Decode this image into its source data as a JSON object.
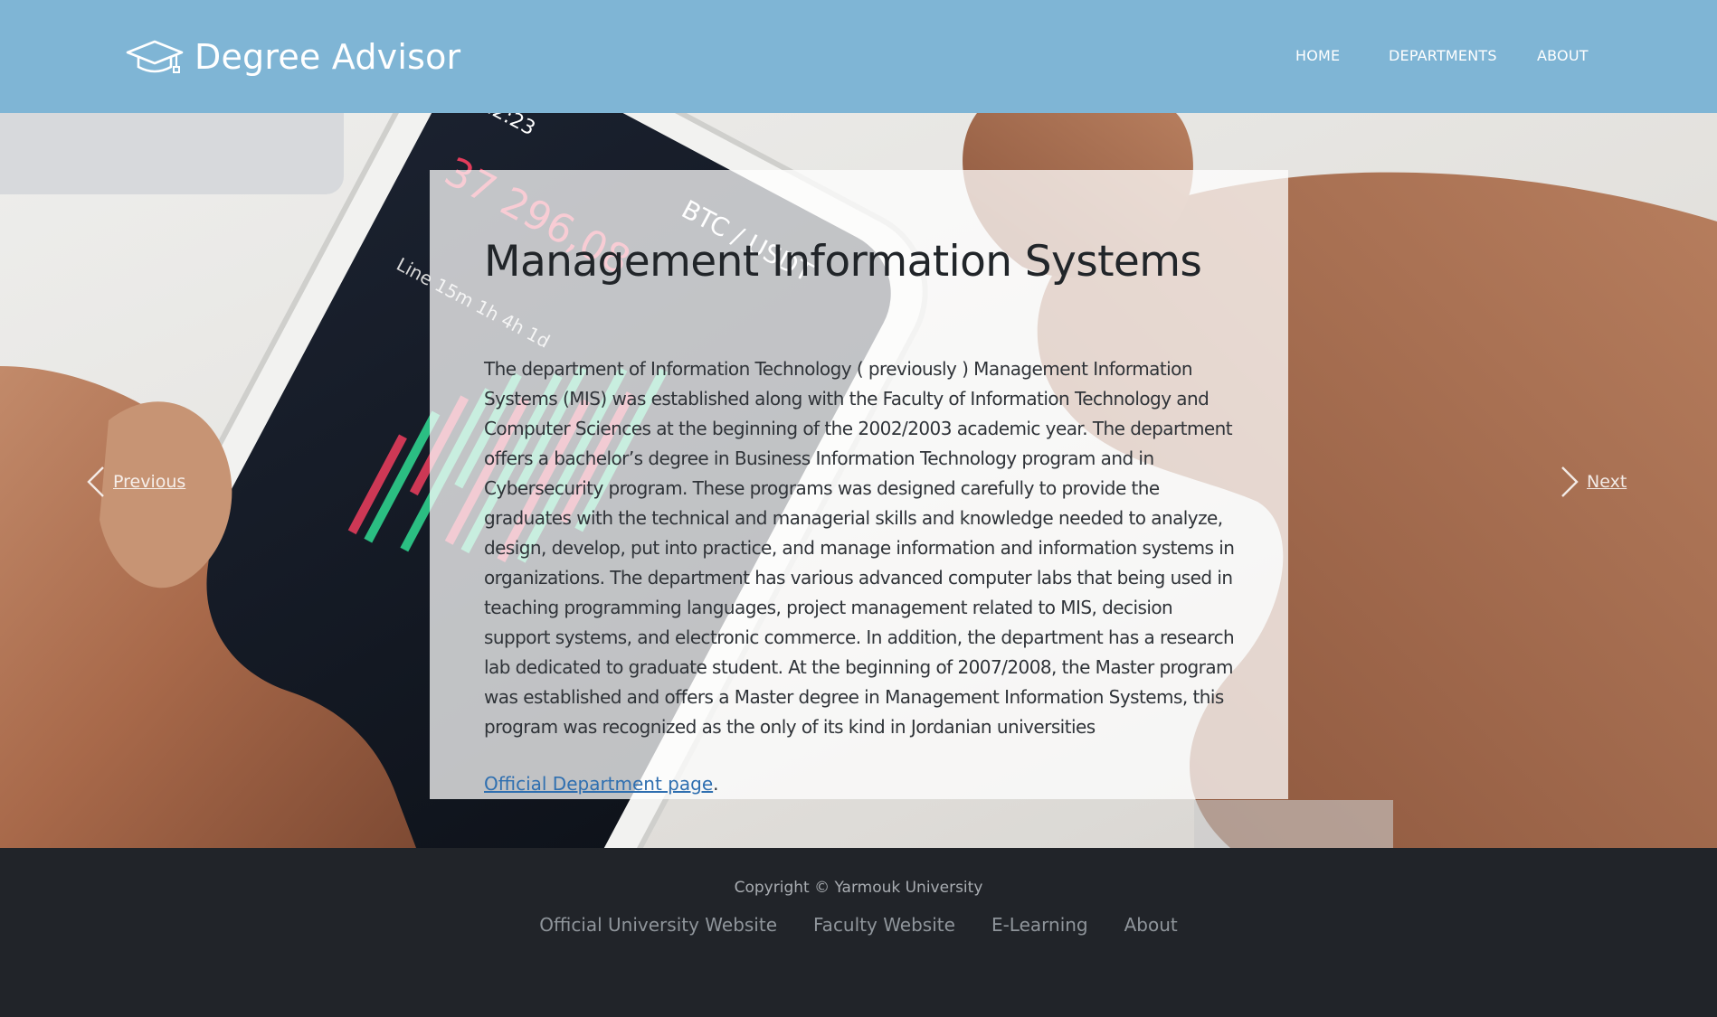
{
  "header": {
    "brand": "Degree Advisor",
    "nav": [
      "HOME",
      "DEPARTMENTS",
      "ABOUT"
    ]
  },
  "carousel": {
    "previous_label": "Previous",
    "next_label": "Next"
  },
  "card": {
    "title": "Management Information Systems",
    "body": "The department of Information Technology ( previously ) Management Information Systems (MIS) was established along with the Faculty of Information Technology and Computer Sciences at the beginning of the 2002/2003 academic year. The department offers a bachelor’s degree in Business Information Technology program and in Cybersecurity program. These programs was designed carefully to provide the graduates with the technical and managerial skills and knowledge needed to analyze, design, develop, put into practice, and manage information and information systems in organizations. The department has various advanced computer labs that being used in teaching programming languages, project management related to MIS, decision support systems, and electronic commerce. In addition, the department has a research lab dedicated to graduate student. At the beginning of 2007/2008, the Master program was established and offers a Master degree in Management Information Systems, this program was recognized as the only of its kind in Jordanian universities",
    "link_label": "Official Department page",
    "link_suffix": "."
  },
  "footer": {
    "copyright": "Copyright © Yarmouk University",
    "links": [
      "Official University Website",
      "Faculty Website",
      "E-Learning",
      "About"
    ]
  },
  "colors": {
    "header_bg": "#7fb5d5",
    "footer_bg": "#212429",
    "link": "#2f6fb0"
  },
  "icons": {
    "brand": "graduation-cap-icon",
    "prev": "chevron-left-icon",
    "next": "chevron-right-icon"
  }
}
